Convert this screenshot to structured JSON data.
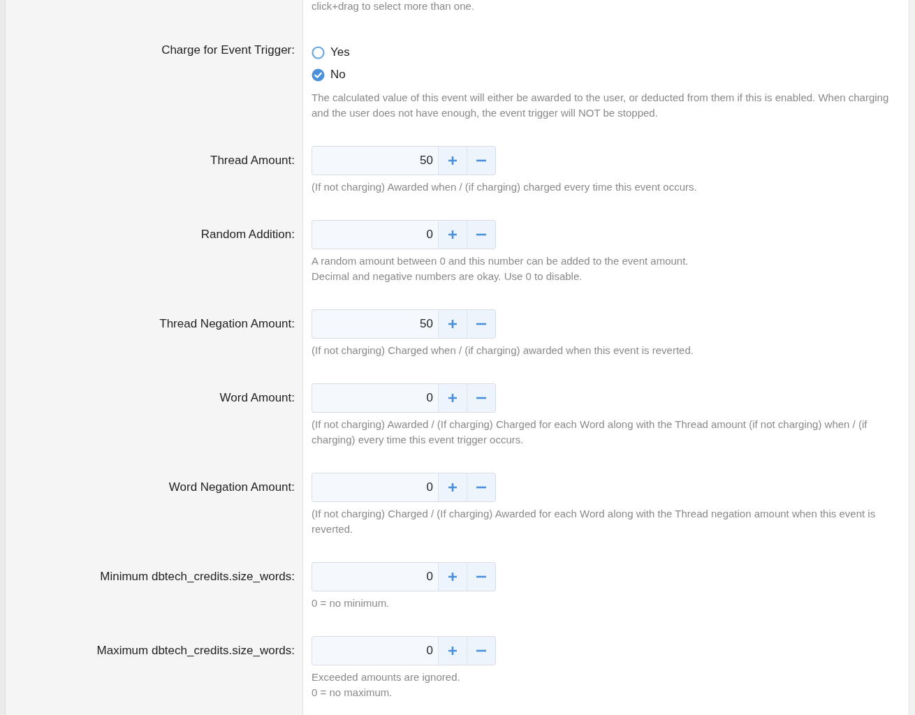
{
  "top_hint": "click+drag to select more than one.",
  "fields": [
    {
      "kind": "radio",
      "label": "Charge for Event Trigger:",
      "options": [
        {
          "label": "Yes",
          "selected": false
        },
        {
          "label": "No",
          "selected": true
        }
      ],
      "hint": [
        "The calculated value of this event will either be awarded to the user, or deducted from them if this is enabled. When charging and the user does not have enough, the event trigger will NOT be stopped."
      ]
    },
    {
      "kind": "number",
      "label": "Thread Amount:",
      "value": "50",
      "hint": [
        "(If not charging) Awarded when / (if charging) charged every time this event occurs."
      ]
    },
    {
      "kind": "number",
      "label": "Random Addition:",
      "value": "0",
      "hint": [
        "A random amount between 0 and this number can be added to the event amount.",
        "Decimal and negative numbers are okay. Use 0 to disable."
      ]
    },
    {
      "kind": "number",
      "label": "Thread Negation Amount:",
      "value": "50",
      "hint": [
        "(If not charging) Charged when / (if charging) awarded when this event is reverted."
      ]
    },
    {
      "kind": "number",
      "label": "Word Amount:",
      "value": "0",
      "hint": [
        "(If not charging) Awarded / (If charging) Charged for each Word along with the Thread amount (if not charging) when / (if charging) every time this event trigger occurs."
      ]
    },
    {
      "kind": "number",
      "label": "Word Negation Amount:",
      "value": "0",
      "hint": [
        "(If not charging) Charged / (If charging) Awarded for each Word along with the Thread negation amount when this event is reverted."
      ]
    },
    {
      "kind": "number",
      "label": "Minimum dbtech_credits.size_words:",
      "value": "0",
      "hint": [
        "0 = no minimum."
      ]
    },
    {
      "kind": "number",
      "label": "Maximum dbtech_credits.size_words:",
      "value": "0",
      "hint": [
        "Exceeded amounts are ignored.",
        "0 = no maximum."
      ]
    }
  ]
}
